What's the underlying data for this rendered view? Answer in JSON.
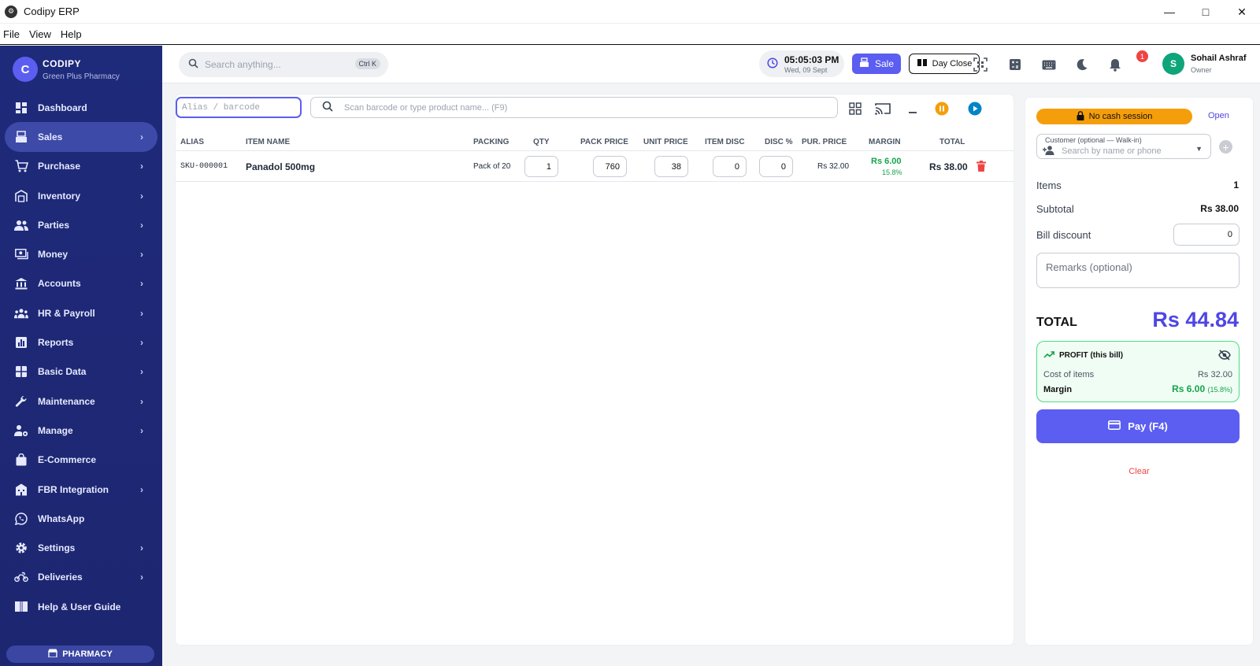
{
  "window": {
    "title": "Codipy ERP",
    "menus": [
      "File",
      "View",
      "Help"
    ]
  },
  "brand": {
    "name": "CODIPY",
    "subtitle": "Green Plus Pharmacy",
    "logo_letter": "C"
  },
  "sidebar": {
    "items": [
      {
        "label": "Dashboard",
        "icon": "dashboard-icon",
        "chevron": false
      },
      {
        "label": "Sales",
        "icon": "cash-register-icon",
        "chevron": true,
        "active": true
      },
      {
        "label": "Purchase",
        "icon": "cart-icon",
        "chevron": true
      },
      {
        "label": "Inventory",
        "icon": "warehouse-icon",
        "chevron": true
      },
      {
        "label": "Parties",
        "icon": "people-icon",
        "chevron": true
      },
      {
        "label": "Money",
        "icon": "money-icon",
        "chevron": true
      },
      {
        "label": "Accounts",
        "icon": "bank-icon",
        "chevron": true
      },
      {
        "label": "HR & Payroll",
        "icon": "team-icon",
        "chevron": true
      },
      {
        "label": "Reports",
        "icon": "chart-icon",
        "chevron": true
      },
      {
        "label": "Basic Data",
        "icon": "grid-icon",
        "chevron": true
      },
      {
        "label": "Maintenance",
        "icon": "wrench-icon",
        "chevron": true
      },
      {
        "label": "Manage",
        "icon": "user-gear-icon",
        "chevron": true
      },
      {
        "label": "E-Commerce",
        "icon": "bag-icon",
        "chevron": false
      },
      {
        "label": "FBR Integration",
        "icon": "building-icon",
        "chevron": true
      },
      {
        "label": "WhatsApp",
        "icon": "whatsapp-icon",
        "chevron": false
      },
      {
        "label": "Settings",
        "icon": "gear-icon",
        "chevron": true
      },
      {
        "label": "Deliveries",
        "icon": "motorbike-icon",
        "chevron": true
      },
      {
        "label": "Help & User Guide",
        "icon": "book-icon",
        "chevron": false
      }
    ],
    "footer_badge": "PHARMACY"
  },
  "topbar": {
    "search_placeholder": "Search anything...",
    "search_shortcut": "Ctrl K",
    "time": "05:05:03 PM",
    "date": "Wed, 09 Sept",
    "sale_label": "Sale",
    "day_close_label": "Day Close",
    "notification_count": "1",
    "user": {
      "initial": "S",
      "name": "Sohail Ashraf",
      "role": "Owner"
    }
  },
  "entry": {
    "alias_placeholder": "Alias / barcode",
    "scan_placeholder": "Scan barcode or type product name... (F9)"
  },
  "table": {
    "headers": [
      "ALIAS",
      "ITEM NAME",
      "PACKING",
      "QTY",
      "PACK PRICE",
      "UNIT PRICE",
      "ITEM DISC",
      "DISC %",
      "PUR. PRICE",
      "MARGIN",
      "TOTAL"
    ],
    "rows": [
      {
        "alias": "SKU-000001",
        "item_name": "Panadol 500mg",
        "packing": "Pack of 20",
        "qty": "1",
        "pack_price": "760",
        "unit_price": "38",
        "item_disc": "0",
        "disc_pct": "0",
        "pur_price": "Rs 32.00",
        "margin": "Rs 6.00",
        "margin_pct": "15.8%",
        "total": "Rs 38.00"
      }
    ]
  },
  "summary": {
    "cash_session": "No cash session",
    "open_label": "Open",
    "customer_label": "Customer (optional — Walk-in)",
    "customer_placeholder": "Search by name or phone",
    "items_label": "Items",
    "items_value": "1",
    "subtotal_label": "Subtotal",
    "subtotal_value": "Rs 38.00",
    "bill_discount_label": "Bill discount",
    "bill_discount_value": "0",
    "remarks_placeholder": "Remarks (optional)",
    "total_label": "TOTAL",
    "total_value": "Rs 44.84",
    "profit": {
      "title": "PROFIT (this bill)",
      "cost_label": "Cost of items",
      "cost_value": "Rs 32.00",
      "margin_label": "Margin",
      "margin_value": "Rs 6.00",
      "margin_pct": "(15.8%)"
    },
    "pay_label": "Pay (F4)",
    "clear_label": "Clear"
  },
  "colors": {
    "accent": "#5b5ef0",
    "sidebar": "#1e2a7a",
    "profit": "#16a34a",
    "danger": "#ef4444",
    "warning": "#f59e0b"
  }
}
